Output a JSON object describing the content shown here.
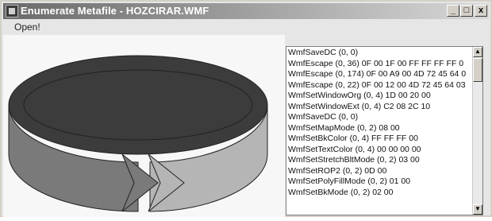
{
  "window": {
    "title": "Enumerate Metafile - HOZCIRAR.WMF",
    "minimize_label": "_",
    "maximize_label": "□",
    "close_label": "x"
  },
  "menu": {
    "open_label": "Open!"
  },
  "canvas": {
    "image_icon": "circular-arrow-graphic"
  },
  "records": [
    "WmfSaveDC (0, 0)",
    "WmfEscape (0, 36) 0F 00 1F 00 FF FF FF FF 0",
    "WmfEscape (0, 174) 0F 00 A9 00 4D 72 45 64 0",
    "WmfEscape (0, 22) 0F 00 12 00 4D 72 45 64 03",
    "WmfSetWindowOrg (0, 4) 1D 00 20 00",
    "WmfSetWindowExt (0, 4) C2 08 2C 10",
    "WmfSaveDC (0, 0)",
    "WmfSetMapMode (0, 2) 08 00",
    "WmfSetBkColor (0, 4) FF FF FF 00",
    "WmfSetTextColor (0, 4) 00 00 00 00",
    "WmfSetStretchBltMode (0, 2) 03 00",
    "WmfSetROP2 (0, 2) 0D 00",
    "WmfSetPolyFillMode (0, 2) 01 00",
    "WmfSetBkMode (0, 2) 02 00"
  ],
  "colors": {
    "ring_outer": "#7a7a7a",
    "ring_inner": "#b5b5b5",
    "ring_top": "#3c3c3c"
  }
}
